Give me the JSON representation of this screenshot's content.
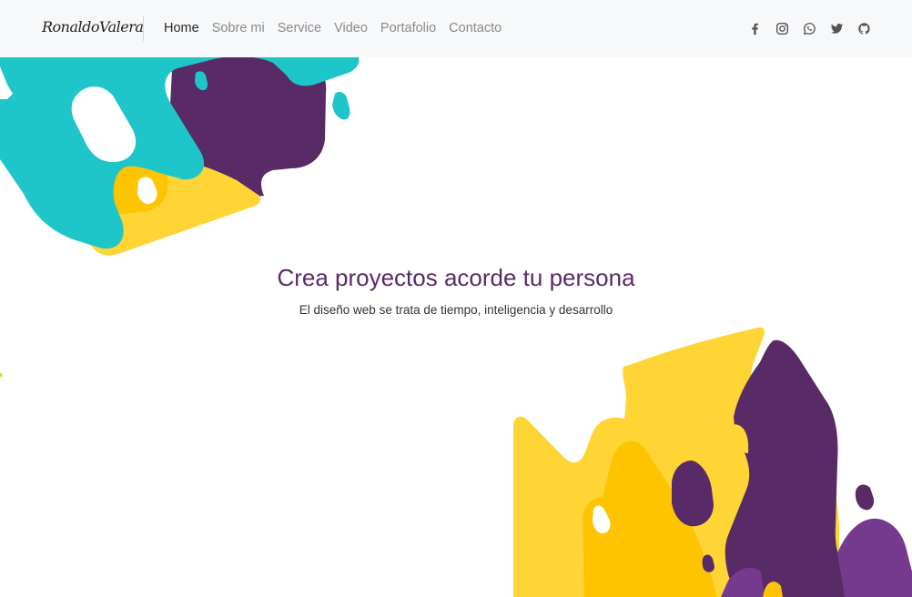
{
  "navbar": {
    "brand": "RonaldoValera",
    "links": [
      {
        "label": "Home",
        "active": true
      },
      {
        "label": "Sobre mi",
        "active": false
      },
      {
        "label": "Service",
        "active": false
      },
      {
        "label": "Video",
        "active": false
      },
      {
        "label": "Portafolio",
        "active": false
      },
      {
        "label": "Contacto",
        "active": false
      }
    ],
    "social_icons": [
      "facebook-icon",
      "instagram-icon",
      "whatsapp-icon",
      "twitter-icon",
      "github-icon"
    ]
  },
  "hero": {
    "title": "Crea proyectos acorde tu persona",
    "subtitle": "El diseño web se trata de tiempo, inteligencia y desarrollo"
  },
  "colors": {
    "accent_purple": "#5a2a66",
    "teal": "#1fc6c9",
    "yellow": "#ffd535",
    "deep_yellow": "#ffc400",
    "dark_purple": "#582a66",
    "violet": "#753a8e",
    "navbar_bg": "#f7f8fa"
  }
}
